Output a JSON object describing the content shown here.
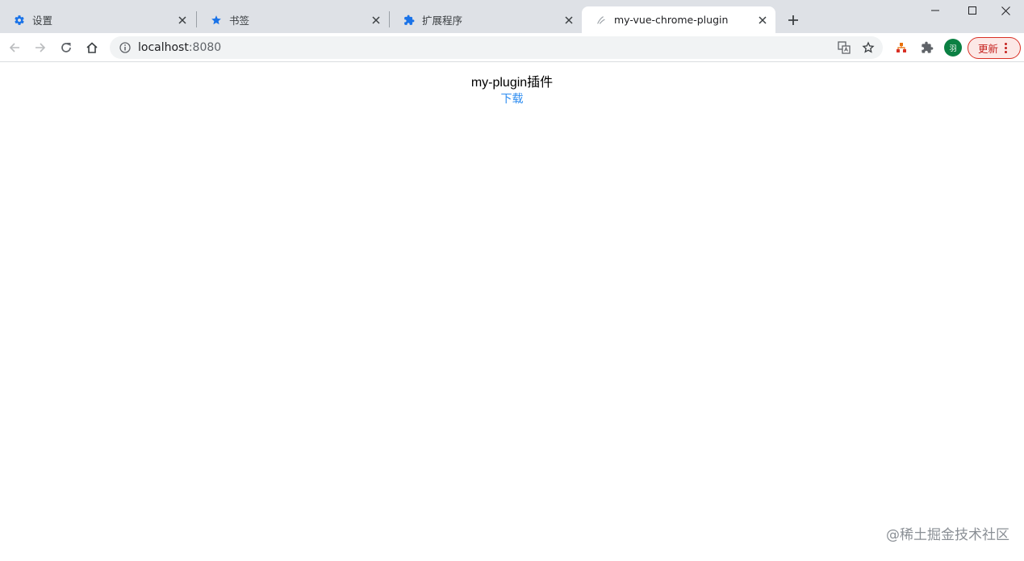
{
  "tabs": [
    {
      "title": "设置",
      "icon": "gear-icon",
      "active": false
    },
    {
      "title": "书签",
      "icon": "star-icon",
      "active": false
    },
    {
      "title": "扩展程序",
      "icon": "puzzle-icon",
      "active": false
    },
    {
      "title": "my-vue-chrome-plugin",
      "icon": "page-loading-icon",
      "active": true
    }
  ],
  "toolbar": {
    "url_host": "localhost",
    "url_port": ":8080",
    "avatar_text": "羽",
    "update_label": "更新"
  },
  "page": {
    "heading": "my-plugin插件",
    "download_link": "下载"
  },
  "watermark": "@稀土掘金技术社区",
  "colors": {
    "tabstrip_bg": "#dee1e6",
    "accent_blue": "#1a73e8",
    "link_blue": "#2d8cf0",
    "update_red": "#c5221f",
    "avatar_green": "#0b8043"
  }
}
